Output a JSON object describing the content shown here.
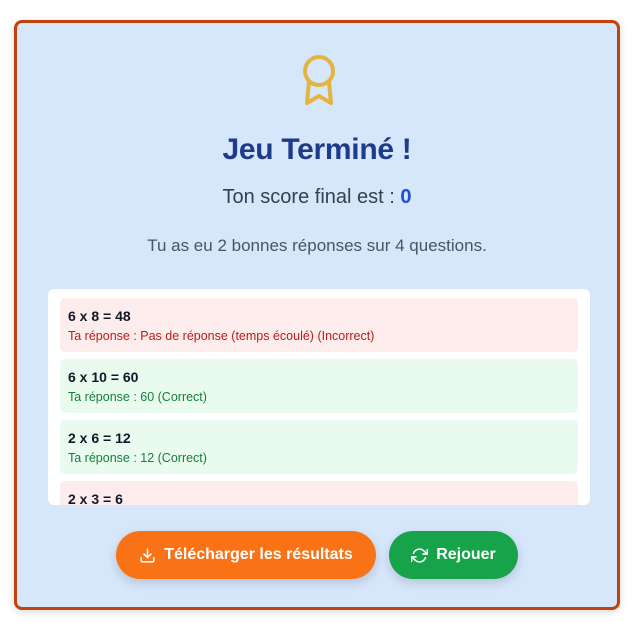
{
  "header": {
    "icon": "award-icon",
    "title": "Jeu Terminé !",
    "score_prefix": "Ton score final est : ",
    "score_value": "0",
    "summary": "Tu as eu 2 bonnes réponses sur 4 questions."
  },
  "results": [
    {
      "question": "6 x 8 = 48",
      "answer": "Ta réponse : Pas de réponse (temps écoulé) (Incorrect)",
      "status": "incorrect"
    },
    {
      "question": "6 x 10 = 60",
      "answer": "Ta réponse : 60 (Correct)",
      "status": "correct"
    },
    {
      "question": "2 x 6 = 12",
      "answer": "Ta réponse : 12 (Correct)",
      "status": "correct"
    },
    {
      "question": "2 x 3 = 6",
      "answer": "",
      "status": "incorrect"
    }
  ],
  "buttons": {
    "download_label": "Télécharger les résultats",
    "download_icon": "download-icon",
    "replay_label": "Rejouer",
    "replay_icon": "refresh-icon"
  },
  "colors": {
    "card_background": "#d6e6fb",
    "card_border": "#c2410c",
    "title": "#1e3a8a",
    "score": "#1d4ed8",
    "award": "#e2b440",
    "incorrect_bg": "#fdecec",
    "incorrect_text": "#b91c1c",
    "correct_bg": "#e9faee",
    "correct_text": "#15803d",
    "download_button": "#f97316",
    "replay_button": "#16a34a"
  }
}
